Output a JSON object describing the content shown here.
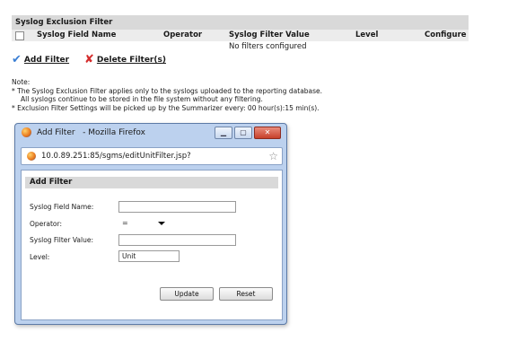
{
  "exclusion_table": {
    "title": "Syslog Exclusion Filter",
    "columns": {
      "field": "Syslog Field Name",
      "operator": "Operator",
      "value": "Syslog Filter Value",
      "level": "Level",
      "configure": "Configure"
    },
    "empty_message": "No filters configured"
  },
  "actions": {
    "add_label": "Add Filter",
    "delete_label": "Delete Filter(s)"
  },
  "notes": {
    "heading": "Note:",
    "line1": "* The Syslog Exclusion Filter applies only to the syslogs uploaded to the reporting database.",
    "line2": "All syslogs continue to be stored in the file system without any filtering.",
    "line3": "* Exclusion Filter Settings will be picked up by the Summarizer every: 00 hour(s):15 min(s)."
  },
  "popup": {
    "window_title": "Add Filter",
    "app_name": "- Mozilla Firefox",
    "url": "10.0.89.251:85/sgms/editUnitFilter.jsp?",
    "form": {
      "title": "Add Filter",
      "field_label": "Syslog Field Name:",
      "field_value": "",
      "operator_label": "Operator:",
      "operator_value": "=",
      "value_label": "Syslog Filter Value:",
      "value_value": "",
      "level_label": "Level:",
      "level_value": "Unit",
      "update_label": "Update",
      "reset_label": "Reset"
    }
  },
  "colors": {
    "add_icon": "#3b7fd4",
    "delete_icon": "#d42c2c",
    "window_frame": "#bcd1ee"
  },
  "icons": {
    "add": "checkmark-icon",
    "delete": "x-mark-icon",
    "browser": "firefox-icon",
    "bookmark": "star-icon"
  }
}
